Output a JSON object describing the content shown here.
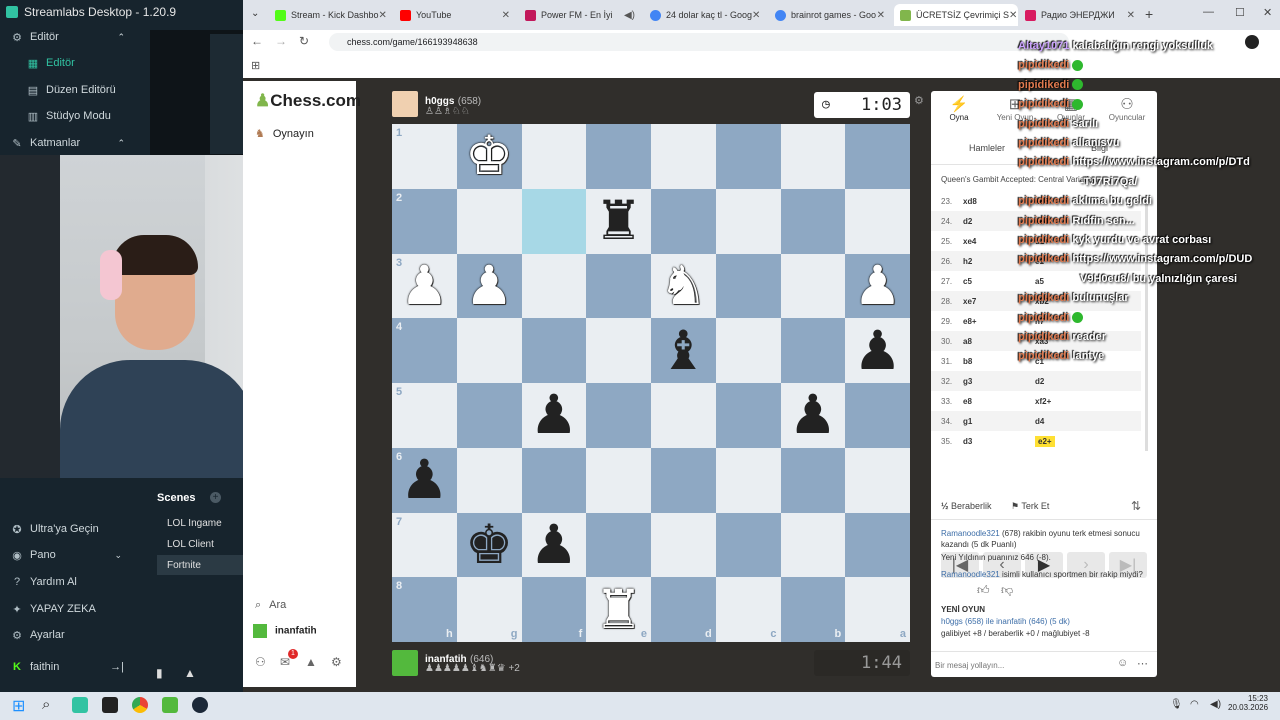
{
  "streamlabs": {
    "title": "Streamlabs Desktop - 1.20.9",
    "nav": [
      {
        "label": "Editör",
        "icon": "sliders-icon"
      },
      {
        "label": "Editör",
        "icon": "grid-icon"
      },
      {
        "label": "Düzen Editörü",
        "icon": "layout-icon"
      },
      {
        "label": "Stüdyo Modu",
        "icon": "studio-icon"
      },
      {
        "label": "Katmanlar",
        "icon": "layers-icon"
      }
    ],
    "scenes_title": "Scenes",
    "scenes": [
      "LOL Ingame",
      "LOL Client",
      "Fortnite"
    ],
    "bottom_nav": [
      {
        "label": "Ultra'ya Geçin",
        "icon": "ultra-icon"
      },
      {
        "label": "Pano",
        "icon": "dashboard-icon"
      },
      {
        "label": "Yardım Al",
        "icon": "help-icon"
      },
      {
        "label": "YAPAY ZEKA",
        "icon": "ai-icon"
      },
      {
        "label": "Ayarlar",
        "icon": "gear-icon"
      }
    ],
    "user": "faithin"
  },
  "browser": {
    "tabs": [
      {
        "label": "Stream - Kick Dashbo",
        "color": "#53fc18"
      },
      {
        "label": "YouTube",
        "color": "#ff0000"
      },
      {
        "label": "Power FM - En İyi",
        "color": "#c2185b"
      },
      {
        "label": "24 dolar kaç tl - Goog",
        "color": "#4285f4"
      },
      {
        "label": "brainrot games - Goo",
        "color": "#4285f4"
      },
      {
        "label": "ÜCRETSİZ Çevrimiçi S",
        "color": "#81b64c"
      },
      {
        "label": "Радио ЭНЕРДЖИ",
        "color": "#d81b60"
      }
    ],
    "url": "chess.com/game/166193948638"
  },
  "chesscom": {
    "logo": "Chess.com",
    "menu_play": "Oynayın",
    "search": "Ara",
    "user": "inanfatih",
    "notif_count": "1"
  },
  "game": {
    "top_player": {
      "name": "h0ggs",
      "rating": "(658)",
      "clock": "1:03"
    },
    "bottom_player": {
      "name": "inanfatih",
      "rating": "(646)",
      "clock": "1:44",
      "extra": "+2"
    },
    "ranks": [
      "1",
      "2",
      "3",
      "4",
      "5",
      "6",
      "7",
      "8"
    ],
    "files": [
      "h",
      "g",
      "f",
      "e",
      "d",
      "c",
      "b",
      "a"
    ],
    "board": [
      [
        "",
        "wK",
        "",
        "",
        "",
        "",
        "",
        ""
      ],
      [
        "",
        "",
        "hl",
        "bR",
        "",
        "",
        "",
        ""
      ],
      [
        "wP",
        "wP",
        "",
        "",
        "wN",
        "",
        "",
        "wP"
      ],
      [
        "",
        "",
        "",
        "",
        "bB",
        "",
        "",
        "bP"
      ],
      [
        "",
        "",
        "bP",
        "",
        "",
        "",
        "bP",
        ""
      ],
      [
        "bP",
        "",
        "",
        "",
        "",
        "",
        "",
        ""
      ],
      [
        "",
        "bK",
        "bP",
        "",
        "",
        "",
        "",
        ""
      ],
      [
        "",
        "",
        "",
        "wR",
        "",
        "",
        "",
        ""
      ]
    ]
  },
  "panel": {
    "tabs": [
      {
        "label": "Oyna",
        "icon": "bolt-icon"
      },
      {
        "label": "Yeni Oyun",
        "icon": "plus-icon"
      },
      {
        "label": "Oyunlar",
        "icon": "games-icon"
      },
      {
        "label": "Oyuncular",
        "icon": "players-icon"
      }
    ],
    "subtab_moves": "Hamleler",
    "subtab_info": "Bilgi",
    "opening": "Queen's Gambit Accepted: Central Variation",
    "moves": [
      {
        "n": "23.",
        "w": "xd8",
        "b": "xd8"
      },
      {
        "n": "24.",
        "w": "d2",
        "b": "xe4"
      },
      {
        "n": "25.",
        "w": "xe4",
        "b": "d1+"
      },
      {
        "n": "26.",
        "w": "h2",
        "b": "e1"
      },
      {
        "n": "27.",
        "w": "c5",
        "b": "a5"
      },
      {
        "n": "28.",
        "w": "xe7",
        "b": "xb2"
      },
      {
        "n": "29.",
        "w": "e8+",
        "b": "h7"
      },
      {
        "n": "30.",
        "w": "a8",
        "b": "xa3"
      },
      {
        "n": "31.",
        "w": "b8",
        "b": "c1"
      },
      {
        "n": "32.",
        "w": "g3",
        "b": "d2"
      },
      {
        "n": "33.",
        "w": "e8",
        "b": "xf2+"
      },
      {
        "n": "34.",
        "w": "g1",
        "b": "d4"
      },
      {
        "n": "35.",
        "w": "d3",
        "b": "e2+"
      }
    ],
    "draw": "Beraberlik",
    "resign": "Terk Et",
    "log": {
      "l1_user": "Ramanoodle321",
      "l1_text": "(678) rakibin oyunu terk etmesi sonucu kazandı (5 dk Puanlı)",
      "l2": "Yeni Yıldının puanınız 646 (-8).",
      "l3_user": "Ramanoodle321",
      "l3_text": "isimli kullanıcı sportmen bir rakip miydi?",
      "new_game": "YENİ OYUN",
      "l4": "h0ggs (658) ile inanfatih (646) (5 dk)",
      "l5": "galibiyet +8 / beraberlik +0 / mağlubiyet -8"
    },
    "chat_placeholder": "Bir mesaj yollayın..."
  },
  "overlay_chat": [
    {
      "name": "Altay1071",
      "text": "kalabalığın rengi yoksulluk"
    },
    {
      "name": "pipidikedi",
      "text": ""
    },
    {
      "name": "pipidikedi",
      "text": ""
    },
    {
      "name": "pipidikedi",
      "text": ""
    },
    {
      "name": "pipidikedi",
      "text": "sarılı"
    },
    {
      "name": "pipidikedi",
      "text": "allanısvu"
    },
    {
      "name": "pipidikedi",
      "text": "https://www.instagram.com/p/DTd"
    },
    {
      "name": "",
      "text": "-TJ7Ri7Qa/"
    },
    {
      "name": "pipidikedi",
      "text": "aklıma bu geldi"
    },
    {
      "name": "pipidikedi",
      "text": "Rıdfin sen..."
    },
    {
      "name": "pipidikedi",
      "text": "kyk yurdu ve avrat corbası"
    },
    {
      "name": "pipidikedi",
      "text": "https://www.instagram.com/p/DUD"
    },
    {
      "name": "",
      "text": "V9H0eu8/ bu yalnızlığın çaresi"
    },
    {
      "name": "pipidikedi",
      "text": "bulunuşlar"
    },
    {
      "name": "pipidikedi",
      "text": ""
    },
    {
      "name": "pipidikedi",
      "text": "reader"
    },
    {
      "name": "pipidikedi",
      "text": "lantye"
    }
  ],
  "taskbar": {
    "time": "15:23",
    "date": "20.03.2026"
  }
}
